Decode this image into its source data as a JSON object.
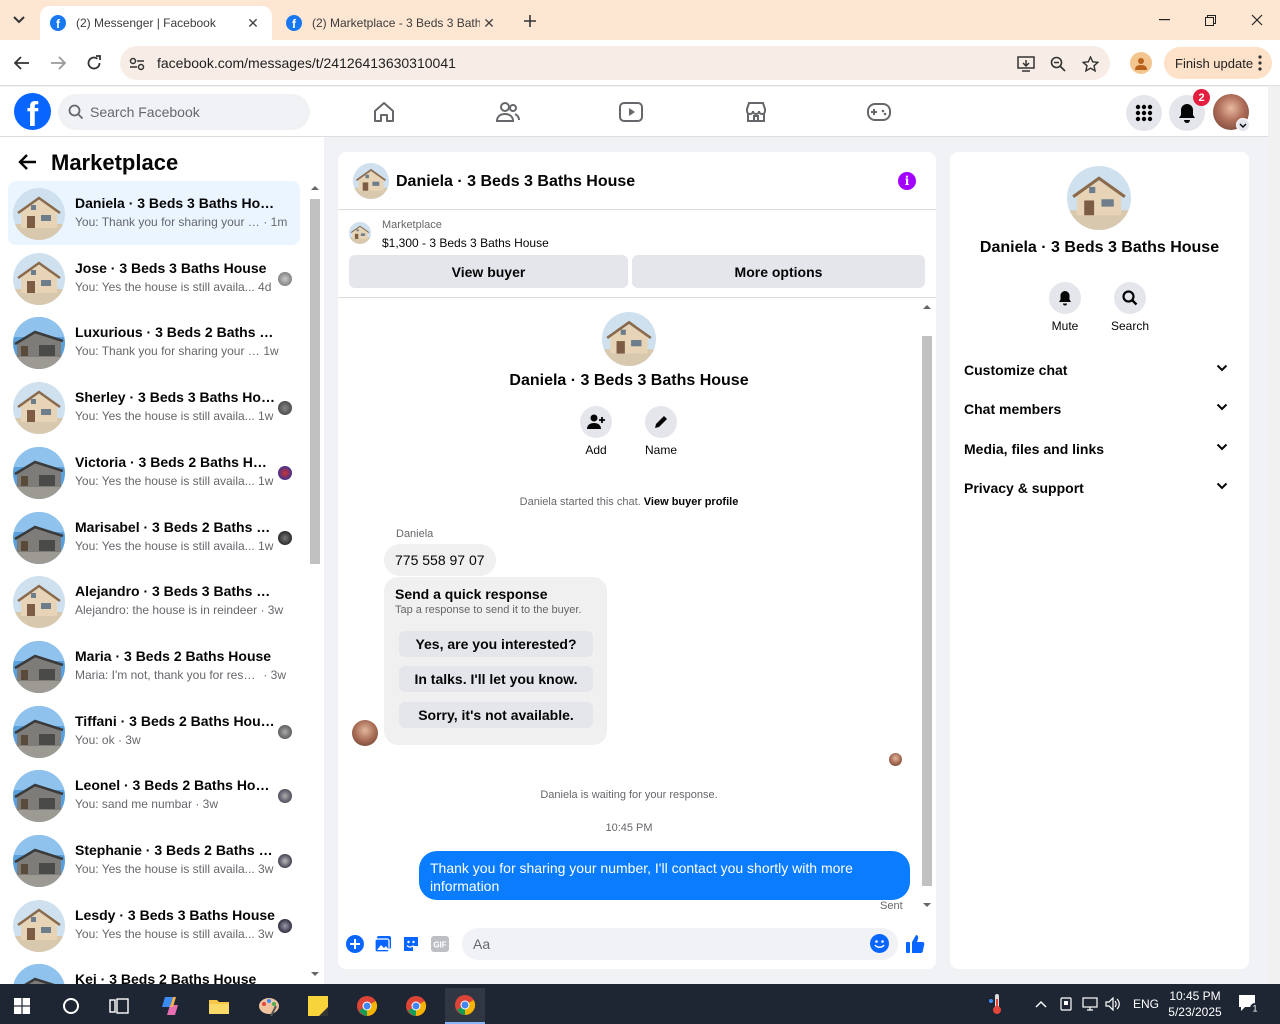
{
  "browser": {
    "tabs": [
      {
        "title": "(2) Messenger | Facebook",
        "active": true
      },
      {
        "title": "(2) Marketplace - 3 Beds 3 Baths",
        "active": false
      }
    ],
    "url": "facebook.com/messages/t/24126413630310041",
    "finish_update": "Finish update"
  },
  "fb": {
    "search_placeholder": "Search Facebook",
    "notif_count": "2",
    "brand_color": "#0866ff"
  },
  "left": {
    "title": "Marketplace",
    "conversations": [
      {
        "name": "Daniela · 3 Beds 3 Baths House",
        "preview": "You: Thank you for sharing your n...",
        "time": "· 1m",
        "house": "tan",
        "selected": true
      },
      {
        "name": "Jose · 3 Beds 3 Baths House",
        "preview": "You: Yes the house is still availa...",
        "time": "4d",
        "house": "tan"
      },
      {
        "name": "Luxurious · 3 Beds 2 Baths House",
        "preview": "You: Thank you for sharing your n...",
        "time": "1w",
        "house": "gray"
      },
      {
        "name": "Sherley · 3 Beds 3 Baths House",
        "preview": "You: Yes the house is still availa...",
        "time": "1w",
        "house": "tan"
      },
      {
        "name": "Victoria · 3 Beds 2 Baths House",
        "preview": "You: Yes the house is still availa...",
        "time": "1w",
        "house": "gray"
      },
      {
        "name": "Marisabel · 3 Beds 2 Baths H...",
        "preview": "You: Yes the house is still availa...",
        "time": "1w",
        "house": "gray"
      },
      {
        "name": "Alejandro · 3 Beds 3 Baths House",
        "preview": "Alejandro: the house is in reindeer",
        "time": "· 3w",
        "house": "tan"
      },
      {
        "name": "Maria · 3 Beds 2 Baths House",
        "preview": "Maria: I'm not, thank you for resp...",
        "time": "· 3w",
        "house": "gray"
      },
      {
        "name": "Tiffani · 3 Beds 2 Baths House",
        "preview": "You: ok",
        "time": "· 3w",
        "house": "gray"
      },
      {
        "name": "Leonel · 3 Beds 2 Baths House",
        "preview": "You: sand me numbar",
        "time": "· 3w",
        "house": "gray"
      },
      {
        "name": "Stephanie · 3 Beds 2 Baths H...",
        "preview": "You: Yes the house is still availa...",
        "time": "3w",
        "house": "gray"
      },
      {
        "name": "Lesdy · 3 Beds 3 Baths House",
        "preview": "You: Yes the house is still availa...",
        "time": "3w",
        "house": "tan"
      },
      {
        "name": "Kei · 3 Beds 2 Baths House",
        "preview": "",
        "time": "",
        "house": "gray"
      }
    ]
  },
  "chat": {
    "title": "Daniela · 3 Beds 3 Baths House",
    "marketplace_label": "Marketplace",
    "listing": "$1,300 - 3 Beds 3 Baths House",
    "view_buyer": "View buyer",
    "more_options": "More options",
    "center_name": "Daniela · 3 Beds 3 Baths House",
    "add_label": "Add",
    "name_label": "Name",
    "started": "Daniela started this chat.",
    "view_profile": "View buyer profile",
    "sender": "Daniela",
    "number_msg": "775 558 97 07",
    "quick_title": "Send a quick response",
    "quick_sub": "Tap a response to send it to the buyer.",
    "quick_options": [
      "Yes, are you interested?",
      "In talks. I'll let you know.",
      "Sorry, it's not available."
    ],
    "waiting": "Daniela is waiting for your response.",
    "time": "10:45 PM",
    "my_msg": "Thank you for sharing your number, I'll contact you shortly with more information",
    "sent": "Sent",
    "composer_placeholder": "Aa",
    "accent": "#0a7cff"
  },
  "right": {
    "name": "Daniela · 3 Beds 3 Baths House",
    "mute": "Mute",
    "search": "Search",
    "sections": [
      "Customize chat",
      "Chat members",
      "Media, files and links",
      "Privacy & support"
    ]
  },
  "taskbar": {
    "lang": "ENG",
    "time": "10:45 PM",
    "date": "5/23/2025",
    "notif": "1"
  }
}
